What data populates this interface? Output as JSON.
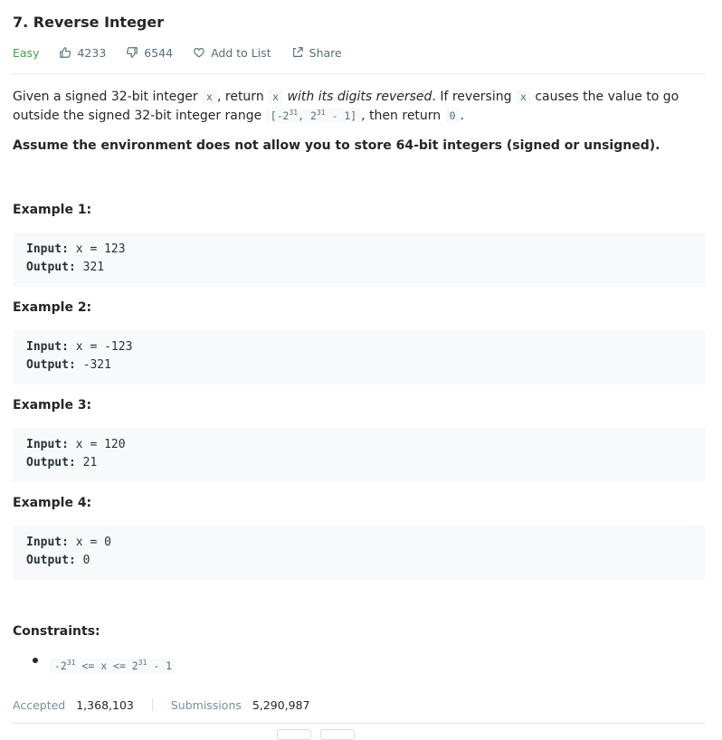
{
  "problem": {
    "title": "7. Reverse Integer",
    "difficulty": "Easy",
    "likes": "4233",
    "dislikes": "6544",
    "add_to_list": "Add to List",
    "share": "Share"
  },
  "description": {
    "p1_a": "Given a signed 32-bit integer ",
    "code_x": "x",
    "p1_b": ", return ",
    "p1_c": " with its digits reversed",
    "p1_d": ". If reversing ",
    "p1_e": " causes the value to go outside the signed 32-bit integer range ",
    "range_a": "[-2",
    "range_exp1": "31",
    "range_b": ", 2",
    "range_exp2": "31",
    "range_c": " - 1]",
    "p1_f": ", then return ",
    "code_zero": "0",
    "p1_g": ".",
    "note": "Assume the environment does not allow you to store 64-bit integers (signed or unsigned)."
  },
  "examples": [
    {
      "title": "Example 1:",
      "input_label": "Input:",
      "input": " x = 123",
      "output_label": "Output:",
      "output": " 321"
    },
    {
      "title": "Example 2:",
      "input_label": "Input:",
      "input": " x = -123",
      "output_label": "Output:",
      "output": " -321"
    },
    {
      "title": "Example 3:",
      "input_label": "Input:",
      "input": " x = 120",
      "output_label": "Output:",
      "output": " 21"
    },
    {
      "title": "Example 4:",
      "input_label": "Input:",
      "input": " x = 0",
      "output_label": "Output:",
      "output": " 0"
    }
  ],
  "constraints": {
    "title": "Constraints:",
    "c1_a": "-2",
    "c1_exp1": "31",
    "c1_b": " <= x <= 2",
    "c1_exp2": "31",
    "c1_c": " - 1"
  },
  "stats": {
    "accepted_label": "Accepted",
    "accepted_value": "1,368,103",
    "submissions_label": "Submissions",
    "submissions_value": "5,290,987"
  },
  "colors": {
    "easy": "#43a047",
    "meta": "#546e7a",
    "code_bg": "#f7f9fa"
  },
  "icons": [
    "thumbs-up-icon",
    "thumbs-down-icon",
    "heart-icon",
    "share-icon"
  ]
}
